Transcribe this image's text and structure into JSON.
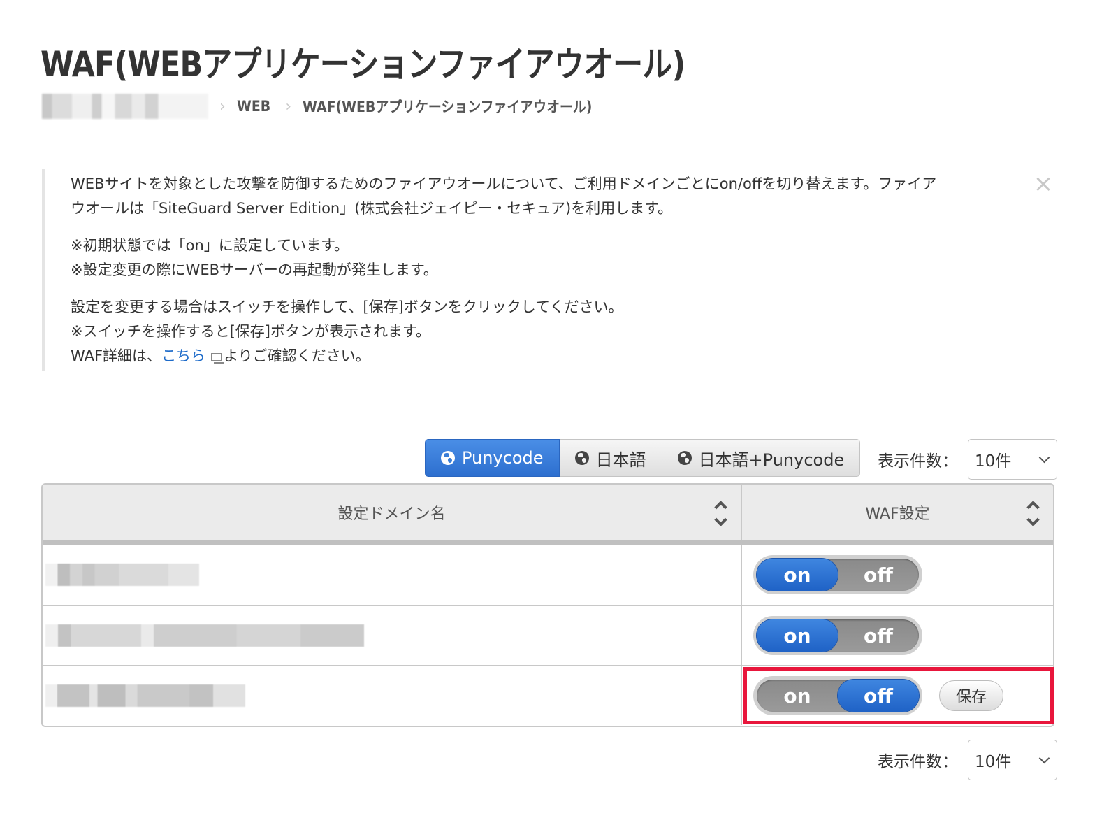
{
  "page": {
    "title": "WAF(WEBアプリケーションファイアウオール)"
  },
  "breadcrumb": {
    "items": [
      {
        "label": "[blurred]",
        "redacted": true
      },
      {
        "label": "WEB"
      },
      {
        "label": "WAF(WEBアプリケーションファイアウオール)"
      }
    ],
    "separator": "›"
  },
  "notice": {
    "paragraph1": {
      "line1": "WEBサイトを対象とした攻撃を防御するためのファイアウオールについて、ご利用ドメインごとにon/offを切り替えます。ファイア",
      "line2": "ウオールは「SiteGuard Server Edition」(株式会社ジェイピー・セキュア)を利用します。"
    },
    "paragraph2": {
      "line1": "※初期状態では「on」に設定しています。",
      "line2": "※設定変更の際にWEBサーバーの再起動が発生します。"
    },
    "paragraph3": {
      "line1": "設定を変更する場合はスイッチを操作して、[保存]ボタンをクリックしてください。",
      "line2": "※スイッチを操作すると[保存]ボタンが表示されます。",
      "line3_prefix": "WAF詳細は、",
      "line3_link": "こちら",
      "line3_suffix": "よりご確認ください。"
    },
    "close_icon": "×"
  },
  "toolbar": {
    "display_modes": [
      {
        "label": "Punycode",
        "icon": "globe-icon",
        "active": true
      },
      {
        "label": "日本語",
        "icon": "globe-icon",
        "active": false
      },
      {
        "label": "日本語+Punycode",
        "icon": "globe-icon",
        "active": false
      }
    ],
    "perpage_label": "表示件数：",
    "perpage_value": "10件"
  },
  "table": {
    "headers": [
      {
        "label": "設定ドメイン名",
        "sortable": true
      },
      {
        "label": "WAF設定",
        "sortable": true
      }
    ],
    "rows": [
      {
        "domain": "[blurred]",
        "waf": "on",
        "on_label": "on",
        "off_label": "off",
        "save_visible": false
      },
      {
        "domain": "[blurred]",
        "waf": "on",
        "on_label": "on",
        "off_label": "off",
        "save_visible": false
      },
      {
        "domain": "[blurred]",
        "waf": "off",
        "on_label": "on",
        "off_label": "off",
        "save_visible": true,
        "save_label": "保存"
      }
    ]
  },
  "footer": {
    "perpage_label": "表示件数：",
    "perpage_value": "10件"
  },
  "colors": {
    "accent_blue": "#2d6fcf",
    "link_blue": "#1e6bc9",
    "highlight_red": "#e8163c",
    "toggle_gray": "#8a8a8a"
  }
}
